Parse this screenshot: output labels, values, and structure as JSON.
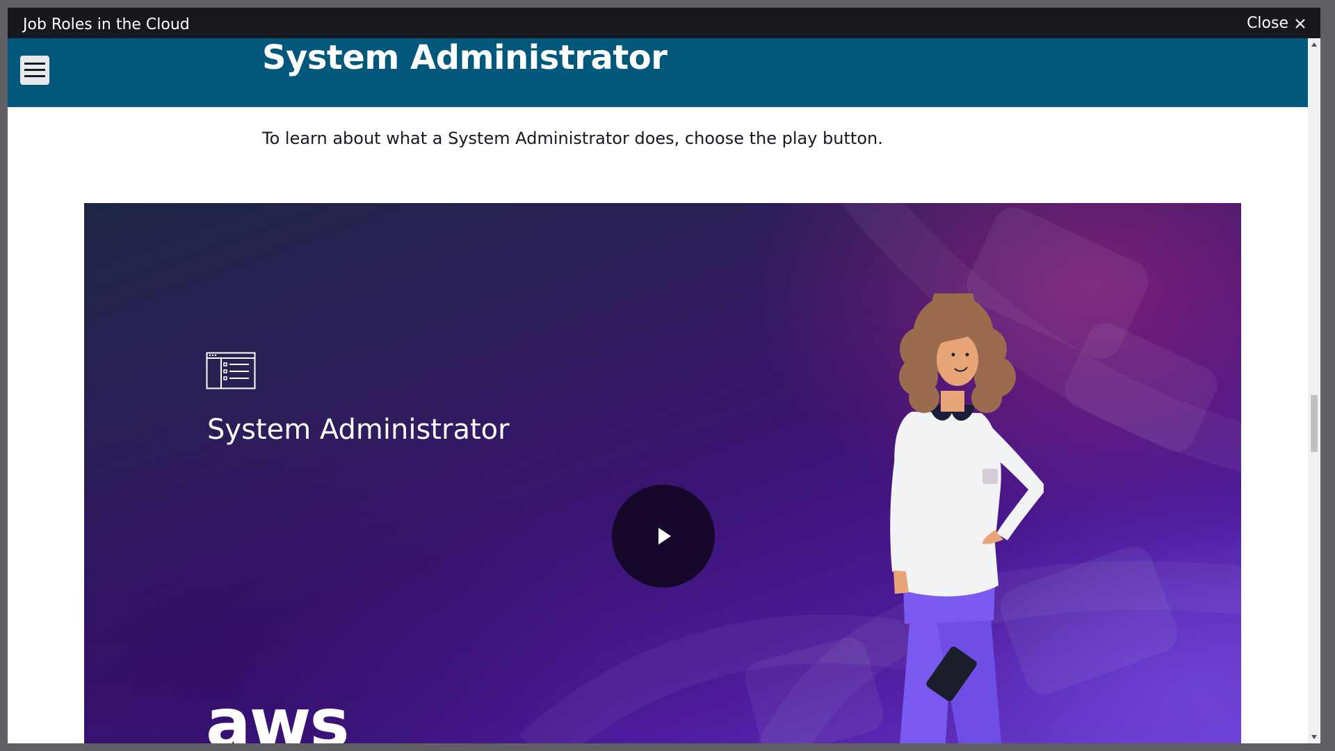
{
  "window": {
    "title": "Job Roles in the Cloud",
    "close_label": "Close"
  },
  "header": {
    "title": "System Administrator"
  },
  "content": {
    "intro": "To learn about what a System Administrator does, choose the play button."
  },
  "video": {
    "title": "System Administrator",
    "logo_text": "aws",
    "role_icon": "list-window-icon",
    "play_icon": "play-icon"
  },
  "colors": {
    "header_bg": "#02587b",
    "titlebar_bg": "#16181d",
    "video_purple": "#4c1a9a"
  }
}
